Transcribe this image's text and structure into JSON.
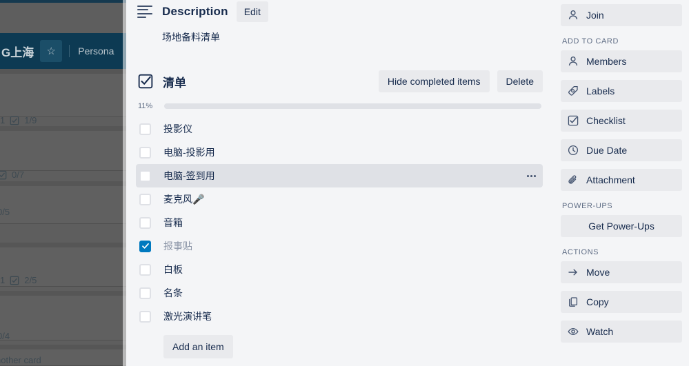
{
  "backdrop": {
    "board_title": "G上海",
    "star_icon": "star-icon",
    "workspace_label": "Persona",
    "cards": [
      {
        "badge_icon": "checklist-badge-icon",
        "badge_text": "1/9",
        "prefix": "1"
      },
      {
        "badge_icon": "checklist-badge-icon",
        "badge_text": "0/7",
        "prefix": ""
      },
      {
        "badge_icon": "checklist-badge-icon",
        "badge_text": "0/5",
        "prefix": ""
      },
      {
        "badge_icon": "checklist-badge-icon",
        "badge_text": "2/5",
        "prefix": "1"
      },
      {
        "badge_icon": "checklist-badge-icon",
        "badge_text": "0/4",
        "prefix": ""
      }
    ],
    "bottom_card_text": "nother card"
  },
  "description": {
    "icon": "description-lines-icon",
    "title": "Description",
    "edit_label": "Edit",
    "body": "场地备料清单"
  },
  "checklist": {
    "icon": "checklist-icon",
    "title": "清单",
    "hide_completed_label": "Hide completed items",
    "delete_label": "Delete",
    "progress_percent_label": "11%",
    "progress_percent": 11,
    "add_item_label": "Add an item",
    "overflow_icon": "more-options-icon",
    "items": [
      {
        "label": "投影仪",
        "checked": false,
        "hovered": false
      },
      {
        "label": "电脑-投影用",
        "checked": false,
        "hovered": false
      },
      {
        "label": "电脑-签到用",
        "checked": false,
        "hovered": true
      },
      {
        "label": "麦克风🎤",
        "checked": false,
        "hovered": false
      },
      {
        "label": "音箱",
        "checked": false,
        "hovered": false
      },
      {
        "label": "报事贴",
        "checked": true,
        "hovered": false
      },
      {
        "label": "白板",
        "checked": false,
        "hovered": false
      },
      {
        "label": "名条",
        "checked": false,
        "hovered": false
      },
      {
        "label": "激光演讲笔",
        "checked": false,
        "hovered": false
      }
    ]
  },
  "sidebar": {
    "join": {
      "label": "Join",
      "icon": "person-icon"
    },
    "add_to_card_heading": "ADD TO CARD",
    "add_to_card": [
      {
        "label": "Members",
        "icon": "person-icon"
      },
      {
        "label": "Labels",
        "icon": "label-tag-icon"
      },
      {
        "label": "Checklist",
        "icon": "checklist-icon"
      },
      {
        "label": "Due Date",
        "icon": "clock-icon"
      },
      {
        "label": "Attachment",
        "icon": "paperclip-icon"
      }
    ],
    "power_ups_heading": "POWER-UPS",
    "get_power_ups_label": "Get Power-Ups",
    "actions_heading": "ACTIONS",
    "actions": [
      {
        "label": "Move",
        "icon": "arrow-right-icon"
      },
      {
        "label": "Copy",
        "icon": "copy-icon"
      },
      {
        "label": "Watch",
        "icon": "eye-icon"
      }
    ]
  },
  "colors": {
    "modal_bg": "#f4f5f7",
    "button_bg": "#e9eaed",
    "accent_blue": "#0079bf",
    "progress_fill": "#5ba4cf",
    "text_primary": "#172b4d",
    "text_muted": "#5e6c84",
    "board_header": "#0d3a53"
  }
}
